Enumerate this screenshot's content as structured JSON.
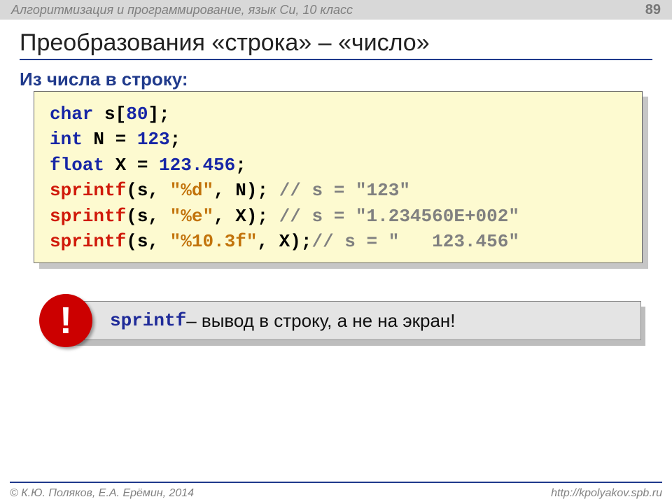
{
  "header": {
    "course": "Алгоритмизация и программирование, язык Си, 10 класс",
    "page": "89"
  },
  "title": "Преобразования «строка» – «число»",
  "subtitle": "Из числа в строку:",
  "code": {
    "l1_kw": "char",
    "l1_rest": " s[",
    "l1_num": "80",
    "l1_end": "];",
    "l2_kw": "int",
    "l2_mid": " N = ",
    "l2_num": "123",
    "l2_end": ";",
    "l3_kw": "float",
    "l3_mid": " X = ",
    "l3_num": "123.456",
    "l3_end": ";",
    "l4_fn": "sprintf",
    "l4_a": "(s, ",
    "l4_str": "\"%d\"",
    "l4_b": ", N); ",
    "l4_c": "// s = \"123\"",
    "l5_fn": "sprintf",
    "l5_a": "(s, ",
    "l5_str": "\"%e\"",
    "l5_b": ", X); ",
    "l5_c": "// s = \"1.234560E+002\"",
    "l6_fn": "sprintf",
    "l6_a": "(s, ",
    "l6_str": "\"%10.3f\"",
    "l6_b": ", X);",
    "l6_c": "// s = \"   123.456\""
  },
  "callout": {
    "bang": "!",
    "fn": "sprintf",
    "text": " – вывод в строку, а не на экран!"
  },
  "footer": {
    "copyright": "© К.Ю. Поляков, Е.А. Ерёмин, 2014",
    "url": "http://kpolyakov.spb.ru"
  }
}
